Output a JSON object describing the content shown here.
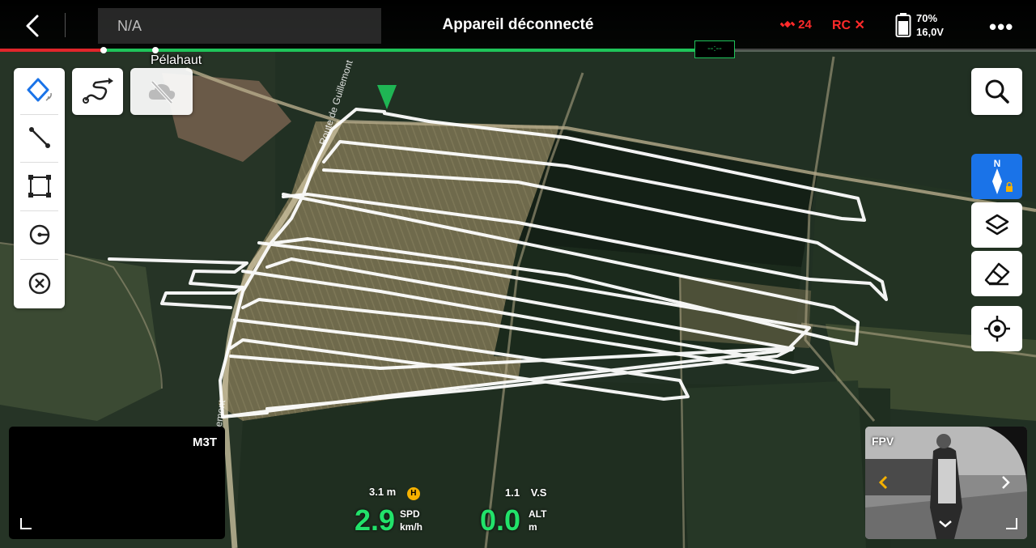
{
  "topbar": {
    "mode": "N/A",
    "status_title": "Appareil déconnecté",
    "gps_count": "24",
    "rc_status": "RC ✕",
    "battery_percent": "70%",
    "battery_voltage": "16,0V",
    "more_label": "•••",
    "progress_marker": "--:--"
  },
  "map": {
    "place_label": "Pélahaut",
    "road_label_1": "Route de Guillemont",
    "road_label_2": "de Guillemont"
  },
  "camera": {
    "label": "M3T"
  },
  "fpv": {
    "label": "FPV"
  },
  "telemetry": {
    "distance_value": "3.1 m",
    "home_badge": "H",
    "vs_value": "1.1",
    "vs_label": "V.S",
    "speed_value": "2.9",
    "speed_label": "SPD",
    "speed_unit": "km/h",
    "alt_value": "0.0",
    "alt_label": "ALT",
    "alt_unit": "m"
  },
  "colors": {
    "accent_green": "#22e26a",
    "alert_red": "#ff2a2a",
    "tool_blue": "#1a73e8",
    "home_yellow": "#f5b100"
  }
}
